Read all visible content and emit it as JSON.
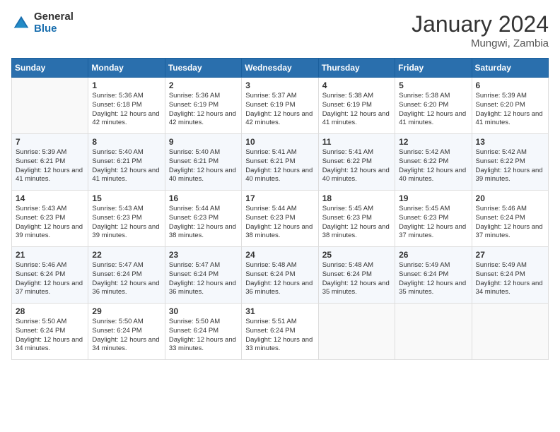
{
  "header": {
    "logo_general": "General",
    "logo_blue": "Blue",
    "month_title": "January 2024",
    "location": "Mungwi, Zambia"
  },
  "weekdays": [
    "Sunday",
    "Monday",
    "Tuesday",
    "Wednesday",
    "Thursday",
    "Friday",
    "Saturday"
  ],
  "weeks": [
    [
      {
        "day": "",
        "sunrise": "",
        "sunset": "",
        "daylight": ""
      },
      {
        "day": "1",
        "sunrise": "Sunrise: 5:36 AM",
        "sunset": "Sunset: 6:18 PM",
        "daylight": "Daylight: 12 hours and 42 minutes."
      },
      {
        "day": "2",
        "sunrise": "Sunrise: 5:36 AM",
        "sunset": "Sunset: 6:19 PM",
        "daylight": "Daylight: 12 hours and 42 minutes."
      },
      {
        "day": "3",
        "sunrise": "Sunrise: 5:37 AM",
        "sunset": "Sunset: 6:19 PM",
        "daylight": "Daylight: 12 hours and 42 minutes."
      },
      {
        "day": "4",
        "sunrise": "Sunrise: 5:38 AM",
        "sunset": "Sunset: 6:19 PM",
        "daylight": "Daylight: 12 hours and 41 minutes."
      },
      {
        "day": "5",
        "sunrise": "Sunrise: 5:38 AM",
        "sunset": "Sunset: 6:20 PM",
        "daylight": "Daylight: 12 hours and 41 minutes."
      },
      {
        "day": "6",
        "sunrise": "Sunrise: 5:39 AM",
        "sunset": "Sunset: 6:20 PM",
        "daylight": "Daylight: 12 hours and 41 minutes."
      }
    ],
    [
      {
        "day": "7",
        "sunrise": "Sunrise: 5:39 AM",
        "sunset": "Sunset: 6:21 PM",
        "daylight": "Daylight: 12 hours and 41 minutes."
      },
      {
        "day": "8",
        "sunrise": "Sunrise: 5:40 AM",
        "sunset": "Sunset: 6:21 PM",
        "daylight": "Daylight: 12 hours and 41 minutes."
      },
      {
        "day": "9",
        "sunrise": "Sunrise: 5:40 AM",
        "sunset": "Sunset: 6:21 PM",
        "daylight": "Daylight: 12 hours and 40 minutes."
      },
      {
        "day": "10",
        "sunrise": "Sunrise: 5:41 AM",
        "sunset": "Sunset: 6:21 PM",
        "daylight": "Daylight: 12 hours and 40 minutes."
      },
      {
        "day": "11",
        "sunrise": "Sunrise: 5:41 AM",
        "sunset": "Sunset: 6:22 PM",
        "daylight": "Daylight: 12 hours and 40 minutes."
      },
      {
        "day": "12",
        "sunrise": "Sunrise: 5:42 AM",
        "sunset": "Sunset: 6:22 PM",
        "daylight": "Daylight: 12 hours and 40 minutes."
      },
      {
        "day": "13",
        "sunrise": "Sunrise: 5:42 AM",
        "sunset": "Sunset: 6:22 PM",
        "daylight": "Daylight: 12 hours and 39 minutes."
      }
    ],
    [
      {
        "day": "14",
        "sunrise": "Sunrise: 5:43 AM",
        "sunset": "Sunset: 6:23 PM",
        "daylight": "Daylight: 12 hours and 39 minutes."
      },
      {
        "day": "15",
        "sunrise": "Sunrise: 5:43 AM",
        "sunset": "Sunset: 6:23 PM",
        "daylight": "Daylight: 12 hours and 39 minutes."
      },
      {
        "day": "16",
        "sunrise": "Sunrise: 5:44 AM",
        "sunset": "Sunset: 6:23 PM",
        "daylight": "Daylight: 12 hours and 38 minutes."
      },
      {
        "day": "17",
        "sunrise": "Sunrise: 5:44 AM",
        "sunset": "Sunset: 6:23 PM",
        "daylight": "Daylight: 12 hours and 38 minutes."
      },
      {
        "day": "18",
        "sunrise": "Sunrise: 5:45 AM",
        "sunset": "Sunset: 6:23 PM",
        "daylight": "Daylight: 12 hours and 38 minutes."
      },
      {
        "day": "19",
        "sunrise": "Sunrise: 5:45 AM",
        "sunset": "Sunset: 6:23 PM",
        "daylight": "Daylight: 12 hours and 37 minutes."
      },
      {
        "day": "20",
        "sunrise": "Sunrise: 5:46 AM",
        "sunset": "Sunset: 6:24 PM",
        "daylight": "Daylight: 12 hours and 37 minutes."
      }
    ],
    [
      {
        "day": "21",
        "sunrise": "Sunrise: 5:46 AM",
        "sunset": "Sunset: 6:24 PM",
        "daylight": "Daylight: 12 hours and 37 minutes."
      },
      {
        "day": "22",
        "sunrise": "Sunrise: 5:47 AM",
        "sunset": "Sunset: 6:24 PM",
        "daylight": "Daylight: 12 hours and 36 minutes."
      },
      {
        "day": "23",
        "sunrise": "Sunrise: 5:47 AM",
        "sunset": "Sunset: 6:24 PM",
        "daylight": "Daylight: 12 hours and 36 minutes."
      },
      {
        "day": "24",
        "sunrise": "Sunrise: 5:48 AM",
        "sunset": "Sunset: 6:24 PM",
        "daylight": "Daylight: 12 hours and 36 minutes."
      },
      {
        "day": "25",
        "sunrise": "Sunrise: 5:48 AM",
        "sunset": "Sunset: 6:24 PM",
        "daylight": "Daylight: 12 hours and 35 minutes."
      },
      {
        "day": "26",
        "sunrise": "Sunrise: 5:49 AM",
        "sunset": "Sunset: 6:24 PM",
        "daylight": "Daylight: 12 hours and 35 minutes."
      },
      {
        "day": "27",
        "sunrise": "Sunrise: 5:49 AM",
        "sunset": "Sunset: 6:24 PM",
        "daylight": "Daylight: 12 hours and 34 minutes."
      }
    ],
    [
      {
        "day": "28",
        "sunrise": "Sunrise: 5:50 AM",
        "sunset": "Sunset: 6:24 PM",
        "daylight": "Daylight: 12 hours and 34 minutes."
      },
      {
        "day": "29",
        "sunrise": "Sunrise: 5:50 AM",
        "sunset": "Sunset: 6:24 PM",
        "daylight": "Daylight: 12 hours and 34 minutes."
      },
      {
        "day": "30",
        "sunrise": "Sunrise: 5:50 AM",
        "sunset": "Sunset: 6:24 PM",
        "daylight": "Daylight: 12 hours and 33 minutes."
      },
      {
        "day": "31",
        "sunrise": "Sunrise: 5:51 AM",
        "sunset": "Sunset: 6:24 PM",
        "daylight": "Daylight: 12 hours and 33 minutes."
      },
      {
        "day": "",
        "sunrise": "",
        "sunset": "",
        "daylight": ""
      },
      {
        "day": "",
        "sunrise": "",
        "sunset": "",
        "daylight": ""
      },
      {
        "day": "",
        "sunrise": "",
        "sunset": "",
        "daylight": ""
      }
    ]
  ]
}
